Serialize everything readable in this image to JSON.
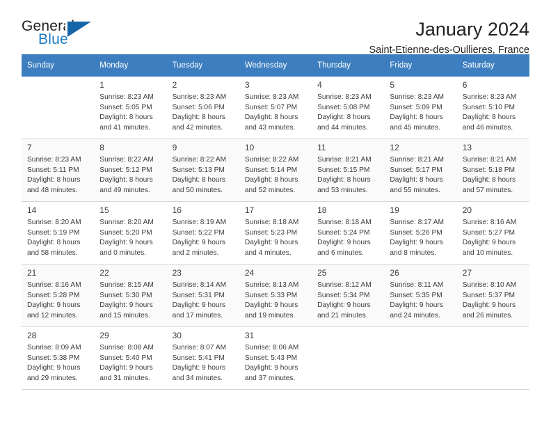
{
  "brand": {
    "name_part1": "General",
    "name_part2": "Blue",
    "logo_icon": "triangle-logo-icon",
    "accent_color": "#1f7bc1"
  },
  "header": {
    "title": "January 2024",
    "subtitle": "Saint-Etienne-des-Oullieres, France"
  },
  "theme": {
    "header_row_bg": "#3c7ebf",
    "header_row_text": "#ffffff",
    "alt_row_bg": "#fafafa",
    "grid_line": "#d7d7d7",
    "text": "#3b3b3b"
  },
  "calendar": {
    "weekday_headers": [
      "Sunday",
      "Monday",
      "Tuesday",
      "Wednesday",
      "Thursday",
      "Friday",
      "Saturday"
    ],
    "weeks": [
      [
        {
          "day": ""
        },
        {
          "day": "1",
          "sunrise": "Sunrise: 8:23 AM",
          "sunset": "Sunset: 5:05 PM",
          "daylight1": "Daylight: 8 hours",
          "daylight2": "and 41 minutes."
        },
        {
          "day": "2",
          "sunrise": "Sunrise: 8:23 AM",
          "sunset": "Sunset: 5:06 PM",
          "daylight1": "Daylight: 8 hours",
          "daylight2": "and 42 minutes."
        },
        {
          "day": "3",
          "sunrise": "Sunrise: 8:23 AM",
          "sunset": "Sunset: 5:07 PM",
          "daylight1": "Daylight: 8 hours",
          "daylight2": "and 43 minutes."
        },
        {
          "day": "4",
          "sunrise": "Sunrise: 8:23 AM",
          "sunset": "Sunset: 5:08 PM",
          "daylight1": "Daylight: 8 hours",
          "daylight2": "and 44 minutes."
        },
        {
          "day": "5",
          "sunrise": "Sunrise: 8:23 AM",
          "sunset": "Sunset: 5:09 PM",
          "daylight1": "Daylight: 8 hours",
          "daylight2": "and 45 minutes."
        },
        {
          "day": "6",
          "sunrise": "Sunrise: 8:23 AM",
          "sunset": "Sunset: 5:10 PM",
          "daylight1": "Daylight: 8 hours",
          "daylight2": "and 46 minutes."
        }
      ],
      [
        {
          "day": "7",
          "sunrise": "Sunrise: 8:23 AM",
          "sunset": "Sunset: 5:11 PM",
          "daylight1": "Daylight: 8 hours",
          "daylight2": "and 48 minutes."
        },
        {
          "day": "8",
          "sunrise": "Sunrise: 8:22 AM",
          "sunset": "Sunset: 5:12 PM",
          "daylight1": "Daylight: 8 hours",
          "daylight2": "and 49 minutes."
        },
        {
          "day": "9",
          "sunrise": "Sunrise: 8:22 AM",
          "sunset": "Sunset: 5:13 PM",
          "daylight1": "Daylight: 8 hours",
          "daylight2": "and 50 minutes."
        },
        {
          "day": "10",
          "sunrise": "Sunrise: 8:22 AM",
          "sunset": "Sunset: 5:14 PM",
          "daylight1": "Daylight: 8 hours",
          "daylight2": "and 52 minutes."
        },
        {
          "day": "11",
          "sunrise": "Sunrise: 8:21 AM",
          "sunset": "Sunset: 5:15 PM",
          "daylight1": "Daylight: 8 hours",
          "daylight2": "and 53 minutes."
        },
        {
          "day": "12",
          "sunrise": "Sunrise: 8:21 AM",
          "sunset": "Sunset: 5:17 PM",
          "daylight1": "Daylight: 8 hours",
          "daylight2": "and 55 minutes."
        },
        {
          "day": "13",
          "sunrise": "Sunrise: 8:21 AM",
          "sunset": "Sunset: 5:18 PM",
          "daylight1": "Daylight: 8 hours",
          "daylight2": "and 57 minutes."
        }
      ],
      [
        {
          "day": "14",
          "sunrise": "Sunrise: 8:20 AM",
          "sunset": "Sunset: 5:19 PM",
          "daylight1": "Daylight: 8 hours",
          "daylight2": "and 58 minutes."
        },
        {
          "day": "15",
          "sunrise": "Sunrise: 8:20 AM",
          "sunset": "Sunset: 5:20 PM",
          "daylight1": "Daylight: 9 hours",
          "daylight2": "and 0 minutes."
        },
        {
          "day": "16",
          "sunrise": "Sunrise: 8:19 AM",
          "sunset": "Sunset: 5:22 PM",
          "daylight1": "Daylight: 9 hours",
          "daylight2": "and 2 minutes."
        },
        {
          "day": "17",
          "sunrise": "Sunrise: 8:18 AM",
          "sunset": "Sunset: 5:23 PM",
          "daylight1": "Daylight: 9 hours",
          "daylight2": "and 4 minutes."
        },
        {
          "day": "18",
          "sunrise": "Sunrise: 8:18 AM",
          "sunset": "Sunset: 5:24 PM",
          "daylight1": "Daylight: 9 hours",
          "daylight2": "and 6 minutes."
        },
        {
          "day": "19",
          "sunrise": "Sunrise: 8:17 AM",
          "sunset": "Sunset: 5:26 PM",
          "daylight1": "Daylight: 9 hours",
          "daylight2": "and 8 minutes."
        },
        {
          "day": "20",
          "sunrise": "Sunrise: 8:16 AM",
          "sunset": "Sunset: 5:27 PM",
          "daylight1": "Daylight: 9 hours",
          "daylight2": "and 10 minutes."
        }
      ],
      [
        {
          "day": "21",
          "sunrise": "Sunrise: 8:16 AM",
          "sunset": "Sunset: 5:28 PM",
          "daylight1": "Daylight: 9 hours",
          "daylight2": "and 12 minutes."
        },
        {
          "day": "22",
          "sunrise": "Sunrise: 8:15 AM",
          "sunset": "Sunset: 5:30 PM",
          "daylight1": "Daylight: 9 hours",
          "daylight2": "and 15 minutes."
        },
        {
          "day": "23",
          "sunrise": "Sunrise: 8:14 AM",
          "sunset": "Sunset: 5:31 PM",
          "daylight1": "Daylight: 9 hours",
          "daylight2": "and 17 minutes."
        },
        {
          "day": "24",
          "sunrise": "Sunrise: 8:13 AM",
          "sunset": "Sunset: 5:33 PM",
          "daylight1": "Daylight: 9 hours",
          "daylight2": "and 19 minutes."
        },
        {
          "day": "25",
          "sunrise": "Sunrise: 8:12 AM",
          "sunset": "Sunset: 5:34 PM",
          "daylight1": "Daylight: 9 hours",
          "daylight2": "and 21 minutes."
        },
        {
          "day": "26",
          "sunrise": "Sunrise: 8:11 AM",
          "sunset": "Sunset: 5:35 PM",
          "daylight1": "Daylight: 9 hours",
          "daylight2": "and 24 minutes."
        },
        {
          "day": "27",
          "sunrise": "Sunrise: 8:10 AM",
          "sunset": "Sunset: 5:37 PM",
          "daylight1": "Daylight: 9 hours",
          "daylight2": "and 26 minutes."
        }
      ],
      [
        {
          "day": "28",
          "sunrise": "Sunrise: 8:09 AM",
          "sunset": "Sunset: 5:38 PM",
          "daylight1": "Daylight: 9 hours",
          "daylight2": "and 29 minutes."
        },
        {
          "day": "29",
          "sunrise": "Sunrise: 8:08 AM",
          "sunset": "Sunset: 5:40 PM",
          "daylight1": "Daylight: 9 hours",
          "daylight2": "and 31 minutes."
        },
        {
          "day": "30",
          "sunrise": "Sunrise: 8:07 AM",
          "sunset": "Sunset: 5:41 PM",
          "daylight1": "Daylight: 9 hours",
          "daylight2": "and 34 minutes."
        },
        {
          "day": "31",
          "sunrise": "Sunrise: 8:06 AM",
          "sunset": "Sunset: 5:43 PM",
          "daylight1": "Daylight: 9 hours",
          "daylight2": "and 37 minutes."
        },
        {
          "day": ""
        },
        {
          "day": ""
        },
        {
          "day": ""
        }
      ]
    ]
  }
}
